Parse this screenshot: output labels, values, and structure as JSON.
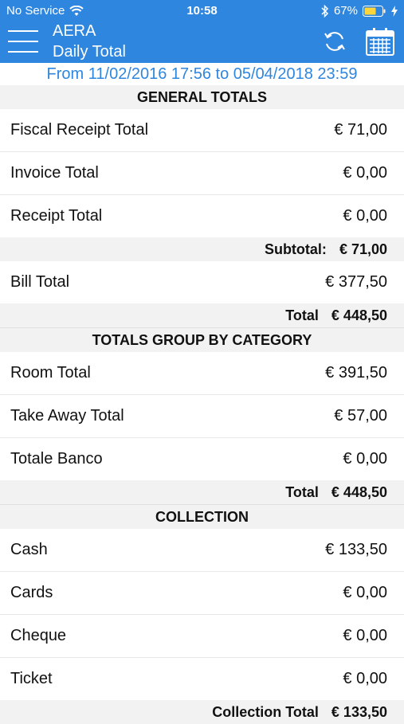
{
  "status_bar": {
    "carrier": "No Service",
    "time": "10:58",
    "battery": "67%"
  },
  "header": {
    "app_name": "AERA",
    "title": "Daily Total"
  },
  "date_range": "From 11/02/2016 17:56 to 05/04/2018 23:59",
  "general_totals": {
    "heading": "GENERAL TOTALS",
    "rows": [
      {
        "label": "Fiscal Receipt Total",
        "value": "€ 71,00"
      },
      {
        "label": "Invoice Total",
        "value": "€ 0,00"
      },
      {
        "label": "Receipt Total",
        "value": "€ 0,00"
      }
    ],
    "subtotal": {
      "label": "Subtotal:",
      "value": "€ 71,00"
    },
    "bill": {
      "label": "Bill Total",
      "value": "€ 377,50"
    },
    "total": {
      "label": "Total",
      "value": "€ 448,50"
    }
  },
  "by_category": {
    "heading": "TOTALS GROUP BY CATEGORY",
    "rows": [
      {
        "label": "Room Total",
        "value": "€ 391,50"
      },
      {
        "label": "Take Away Total",
        "value": "€ 57,00"
      },
      {
        "label": "Totale Banco",
        "value": "€ 0,00"
      }
    ],
    "total": {
      "label": "Total",
      "value": "€ 448,50"
    }
  },
  "collection": {
    "heading": "COLLECTION",
    "rows": [
      {
        "label": "Cash",
        "value": "€ 133,50"
      },
      {
        "label": "Cards",
        "value": "€ 0,00"
      },
      {
        "label": "Cheque",
        "value": "€ 0,00"
      },
      {
        "label": "Ticket",
        "value": "€ 0,00"
      }
    ],
    "total": {
      "label": "Collection Total",
      "value": "€ 133,50"
    }
  },
  "icons": {
    "menu": "hamburger-icon",
    "refresh": "refresh-icon",
    "calendar": "calendar-icon",
    "wifi": "wifi-icon",
    "bluetooth": "bluetooth-icon",
    "battery": "battery-icon"
  },
  "colors": {
    "accent": "#2f86de",
    "section_bg": "#f2f2f2"
  }
}
